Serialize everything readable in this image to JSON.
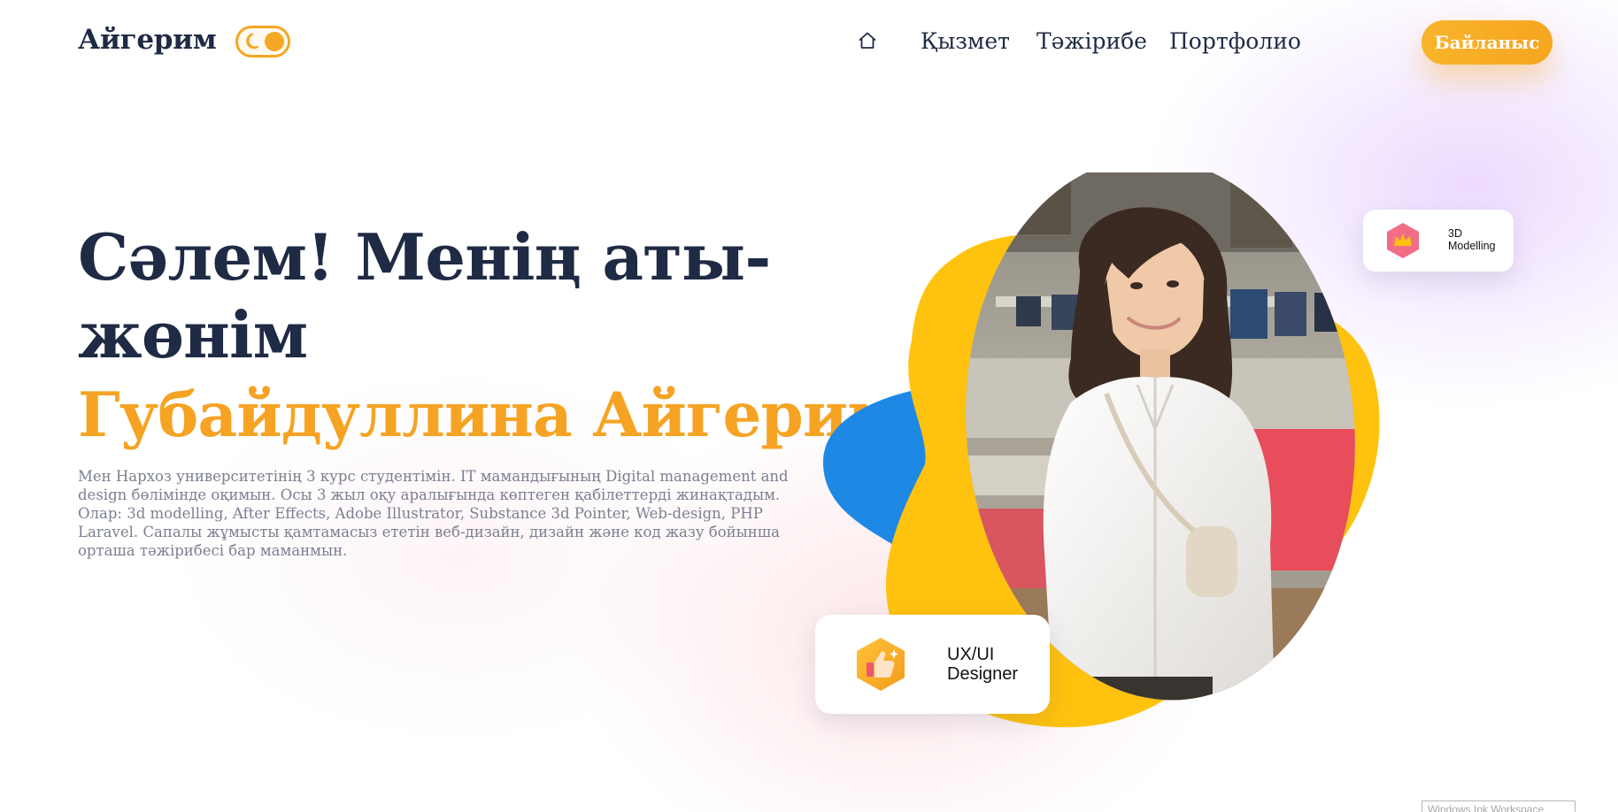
{
  "header": {
    "logo": "Айгерим",
    "theme_toggle_icon": "moon-icon",
    "home_icon": "home-icon",
    "nav": [
      {
        "label": "Қызмет"
      },
      {
        "label": "Тәжірибе"
      },
      {
        "label": "Портфолио"
      }
    ],
    "contact_label": "Байланыс"
  },
  "hero": {
    "greeting_line1": "Сәлем! Менің аты-",
    "greeting_line2": "жөнім",
    "name": "Губайдуллина Айгерим",
    "description": "Мен Нархоз университетінің 3 курс студентімін. IT мамандығының Digital management and design бөлімінде оқимын. Осы 3 жыл оқу аралығында көптеген қабілеттерді жинақтадым. Олар: 3d modelling, After Effects, Adobe Illustrator, Substance 3d Pointer, Web-design, PHP Laravel. Сапалы жұмысты қамтамасыз ететін веб-дизайн, дизайн және код жазу бойынша орташа тәжірибесі бар маманмын."
  },
  "skills": [
    {
      "label": "3D Modelling",
      "icon": "crown-icon"
    },
    {
      "label": "UX/UI Designer",
      "icon": "thumbs-up-icon"
    }
  ],
  "overlay": {
    "label": "Windows Ink Workspace"
  },
  "colors": {
    "accent": "#f6a323",
    "primary_text": "#1f2a44",
    "muted_text": "#7b7f92",
    "blob_yellow": "#ffc20e",
    "blob_blue": "#1e88e5"
  }
}
